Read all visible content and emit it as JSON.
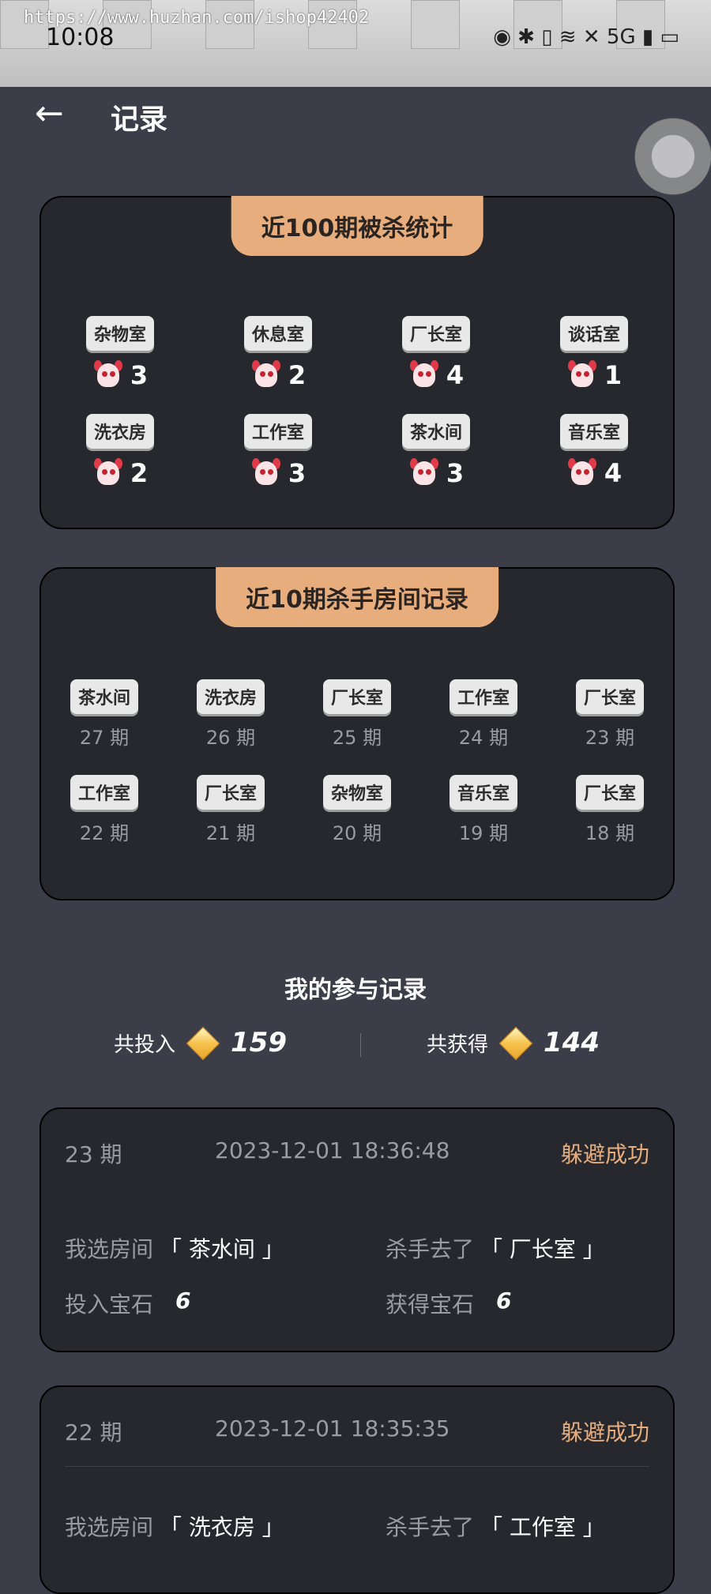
{
  "status": {
    "time": "10:08",
    "watermark": "https://www.huzhan.com/ishop42402",
    "icons": "◉ ✱ ▯ ≋ ✕ 5G ▮ ▭"
  },
  "header": {
    "back_icon": "←",
    "title": "记录"
  },
  "kill_stats": {
    "title": "近100期被杀统计",
    "rooms": [
      {
        "name": "杂物室",
        "count": "3"
      },
      {
        "name": "休息室",
        "count": "2"
      },
      {
        "name": "厂长室",
        "count": "4"
      },
      {
        "name": "谈话室",
        "count": "1"
      },
      {
        "name": "洗衣房",
        "count": "2"
      },
      {
        "name": "工作室",
        "count": "3"
      },
      {
        "name": "茶水间",
        "count": "3"
      },
      {
        "name": "音乐室",
        "count": "4"
      }
    ]
  },
  "killer_rooms": {
    "title": "近10期杀手房间记录",
    "items": [
      {
        "room": "茶水间",
        "period": "27 期"
      },
      {
        "room": "洗衣房",
        "period": "26 期"
      },
      {
        "room": "厂长室",
        "period": "25 期"
      },
      {
        "room": "工作室",
        "period": "24 期"
      },
      {
        "room": "厂长室",
        "period": "23 期"
      },
      {
        "room": "工作室",
        "period": "22 期"
      },
      {
        "room": "厂长室",
        "period": "21 期"
      },
      {
        "room": "杂物室",
        "period": "20 期"
      },
      {
        "room": "音乐室",
        "period": "19 期"
      },
      {
        "room": "厂长室",
        "period": "18 期"
      }
    ]
  },
  "my_records": {
    "title": "我的参与记录",
    "total_in_label": "共投入",
    "total_in": "159",
    "total_out_label": "共获得",
    "total_out": "144",
    "records": [
      {
        "period": "23 期",
        "time": "2023-12-01 18:36:48",
        "result": "躲避成功",
        "my_room_label": "我选房间",
        "my_room": "「 茶水间 」",
        "killer_label": "杀手去了",
        "killer_room": "「 厂长室 」",
        "in_label": "投入宝石",
        "in_value": "6",
        "out_label": "获得宝石",
        "out_value": "6"
      },
      {
        "period": "22 期",
        "time": "2023-12-01 18:35:35",
        "result": "躲避成功",
        "my_room_label": "我选房间",
        "my_room": "「 洗衣房 」",
        "killer_label": "杀手去了",
        "killer_room": "「 工作室 」"
      }
    ]
  }
}
